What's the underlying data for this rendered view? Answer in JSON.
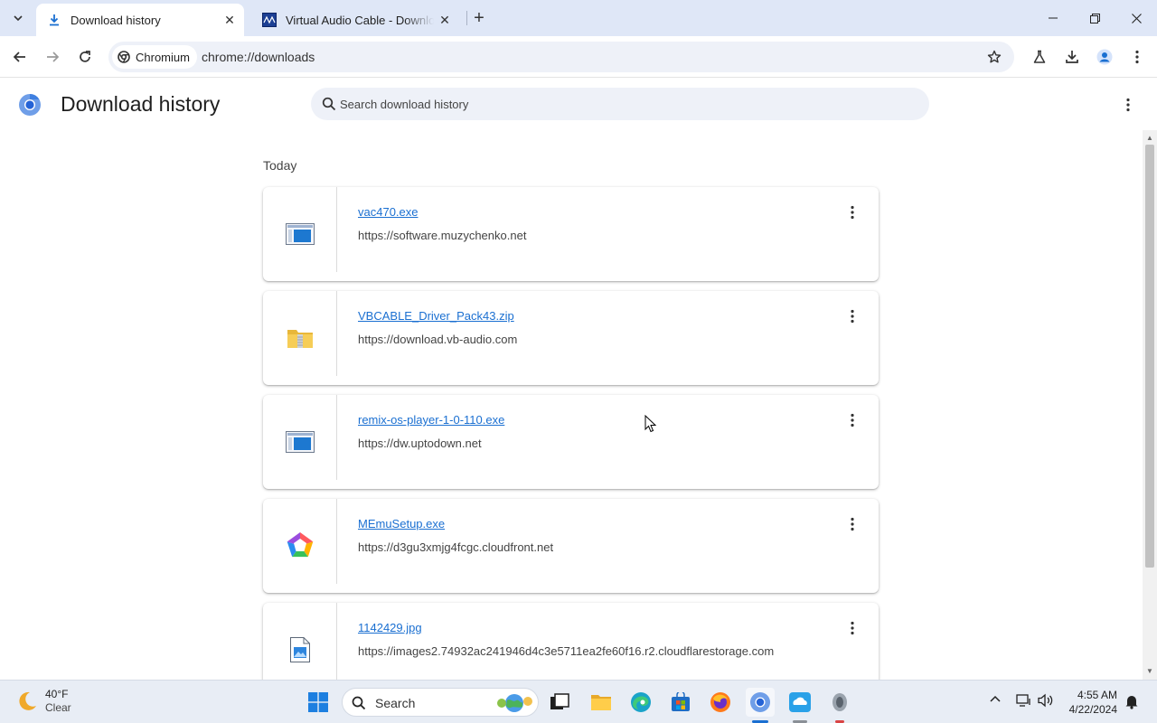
{
  "browser": {
    "tabs": [
      {
        "title": "Download history",
        "active": true
      },
      {
        "title": "Virtual Audio Cable - Download",
        "active": false
      }
    ],
    "chip_label": "Chromium",
    "url": "chrome://downloads"
  },
  "page": {
    "title": "Download history",
    "search_placeholder": "Search download history",
    "section_label": "Today"
  },
  "downloads": [
    {
      "file": "vac470.exe",
      "source": "https://software.muzychenko.net",
      "icon": "exe-window-icon"
    },
    {
      "file": "VBCABLE_Driver_Pack43.zip",
      "source": "https://download.vb-audio.com",
      "icon": "zip-folder-icon"
    },
    {
      "file": "remix-os-player-1-0-110.exe",
      "source": "https://dw.uptodown.net",
      "icon": "exe-window-icon"
    },
    {
      "file": "MEmuSetup.exe",
      "source": "https://d3gu3xmjg4fcgc.cloudfront.net",
      "icon": "memu-logo-icon"
    },
    {
      "file": "1142429.jpg",
      "source": "https://images2.74932ac241946d4c3e5711ea2fe60f16.r2.cloudflarestorage.com",
      "icon": "image-file-icon"
    }
  ],
  "taskbar": {
    "temperature": "40°F",
    "condition": "Clear",
    "search_label": "Search",
    "time": "4:55 AM",
    "date": "4/22/2024"
  },
  "colors": {
    "tabstrip": "#dfe7f7",
    "link": "#1a6fd1",
    "taskbar": "#e8edf5"
  }
}
